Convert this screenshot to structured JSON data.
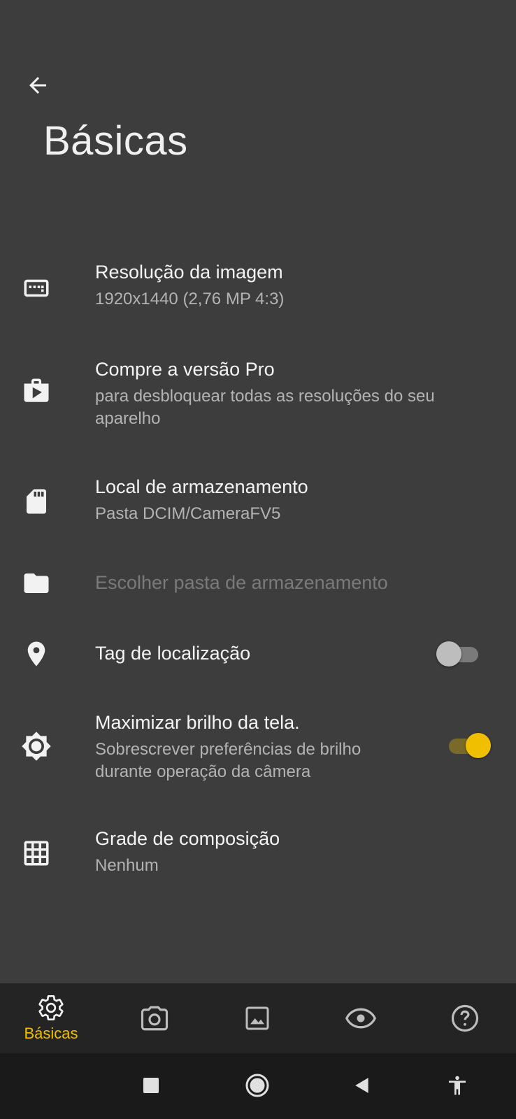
{
  "header": {
    "title": "Básicas"
  },
  "settings": [
    {
      "title": "Resolução da imagem",
      "summary": "1920x1440 (2,76 MP 4:3)",
      "icon": "resolution-icon"
    },
    {
      "title": "Compre a versão Pro",
      "summary": "para desbloquear todas as resoluções do seu aparelho",
      "icon": "shop-icon"
    },
    {
      "title": "Local de armazenamento",
      "summary": "Pasta DCIM/CameraFV5",
      "icon": "sd-card-icon"
    },
    {
      "title": "Escolher pasta de armazenamento",
      "icon": "folder-icon",
      "disabled": true
    },
    {
      "title": "Tag de localização",
      "icon": "location-pin-icon",
      "toggle": "off"
    },
    {
      "title": "Maximizar brilho da tela.",
      "summary": "Sobrescrever preferências de brilho durante operação da câmera",
      "icon": "brightness-icon",
      "toggle": "on"
    },
    {
      "title": "Grade de composição",
      "summary": "Nenhum",
      "icon": "grid-icon"
    }
  ],
  "bottom_nav": {
    "items": [
      {
        "label": "Básicas",
        "icon": "gear-icon",
        "active": true
      },
      {
        "icon": "camera-icon"
      },
      {
        "icon": "image-icon"
      },
      {
        "icon": "eye-icon"
      },
      {
        "icon": "help-icon"
      }
    ]
  },
  "colors": {
    "background": "#3d3d3d",
    "accent": "#f0c000",
    "nav_bg": "#242424",
    "system_bar_bg": "#1a1a1a"
  }
}
